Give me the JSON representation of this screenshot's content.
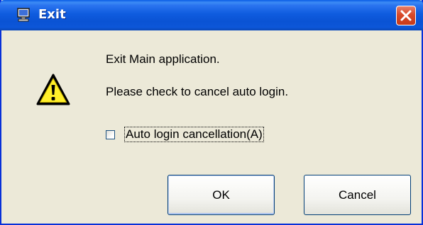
{
  "window": {
    "title": "Exit",
    "title_icon": "computer-monitor-icon",
    "close_icon": "close-icon",
    "titlebar_color": "#0a53d4",
    "close_color": "#d84a2a"
  },
  "dialog": {
    "icon": "warning-icon",
    "message_line1": "Exit Main application.",
    "message_line2": "Please check to cancel auto login.",
    "checkbox_label": "Auto login cancellation(A)",
    "checkbox_checked": false
  },
  "buttons": {
    "ok_label": "OK",
    "cancel_label": "Cancel"
  }
}
